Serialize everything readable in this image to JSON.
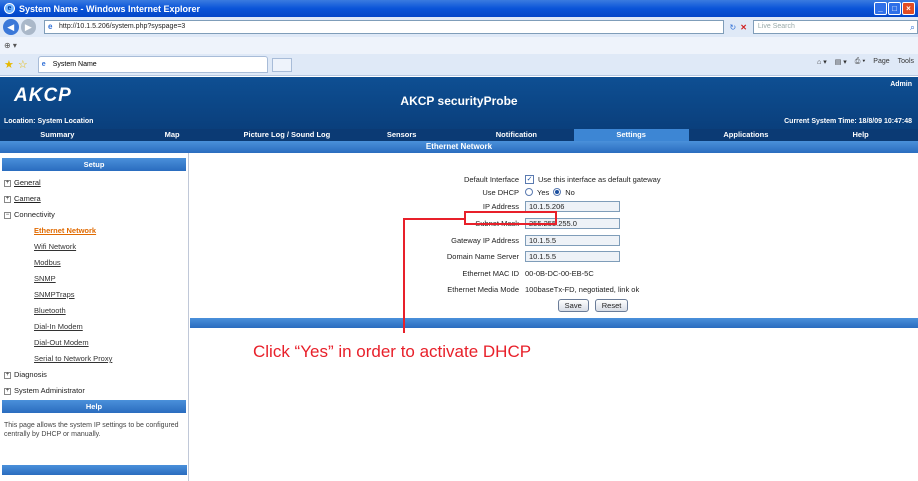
{
  "browser": {
    "title": "System Name - Windows Internet Explorer",
    "url": "http://10.1.5.206/system.php?syspage=3",
    "search_placeholder": "Live Search",
    "tab_label": "System Name",
    "tools": [
      "Page",
      "Tools"
    ]
  },
  "header": {
    "logo": "AKCP",
    "product": "AKCP securityProbe",
    "user": "Admin",
    "location": "Location: System Location",
    "time": "Current System Time: 18/8/09 10:47:48"
  },
  "nav": {
    "items": [
      "Summary",
      "Map",
      "Picture Log / Sound Log",
      "Sensors",
      "Notification",
      "Settings",
      "Applications",
      "Help"
    ],
    "active": "Settings"
  },
  "section_title": "Ethernet Network",
  "sidebar": {
    "setup_title": "Setup",
    "groups": {
      "general": "General",
      "camera": "Camera",
      "connectivity": "Connectivity",
      "diagnosis": "Diagnosis",
      "sysadmin": "System Administrator"
    },
    "connectivity_items": [
      "Ethernet Network",
      "Wifi Network",
      "Modbus",
      "SNMP",
      "SNMPTraps",
      "Bluetooth",
      "Dial-In Modem",
      "Dial-Out Modem",
      "Serial to Network Proxy"
    ],
    "help_title": "Help",
    "help_text": "This page allows the system IP settings to be configured centrally by DHCP or manually."
  },
  "form": {
    "default_interface_label": "Default Interface",
    "default_interface_text": "Use this interface as default gateway",
    "use_dhcp_label": "Use DHCP",
    "dhcp_yes": "Yes",
    "dhcp_no": "No",
    "dhcp_selected": "No",
    "ip_label": "IP Address",
    "ip_value": "10.1.5.206",
    "subnet_label": "Subnet Mask",
    "subnet_value": "255.255.255.0",
    "gateway_label": "Gateway IP Address",
    "gateway_value": "10.1.5.5",
    "dns_label": "Domain Name Server",
    "dns_value": "10.1.5.5",
    "mac_label": "Ethernet MAC ID",
    "mac_value": "00-0B-DC-00-EB-5C",
    "media_label": "Ethernet Media Mode",
    "media_value": "100baseTx-FD, negotiated, link ok",
    "save": "Save",
    "reset": "Reset"
  },
  "annotation": "Click “Yes” in order to activate DHCP",
  "colors": {
    "highlight": "#e8202a",
    "banner": "#0e4f93",
    "active_link": "#e06a00"
  }
}
